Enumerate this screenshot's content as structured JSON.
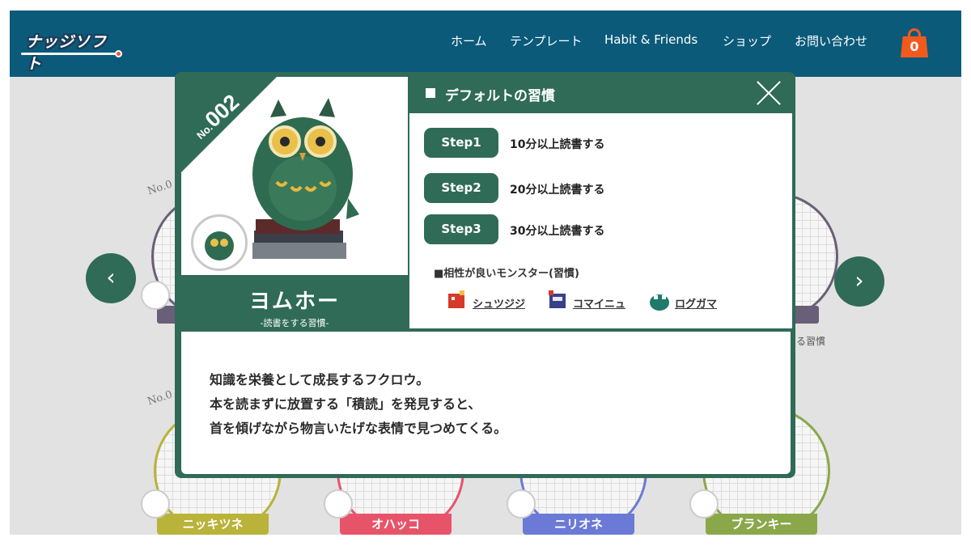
{
  "header": {
    "logo_text": "ナッジソフト",
    "nav": [
      {
        "label": "ホーム"
      },
      {
        "label": "テンプレート"
      },
      {
        "label": "Habit & Friends"
      },
      {
        "label": "ショップ"
      },
      {
        "label": "お問い合わせ"
      }
    ],
    "cart_count": "0"
  },
  "background_cards": [
    {
      "no": "No.0",
      "label": "",
      "color": "#6a5f78"
    },
    {
      "no": "No.0",
      "label": "ニッキツネ",
      "color": "#b9b33a"
    },
    {
      "no": "",
      "label": "オハッコ",
      "color": "#e7546a"
    },
    {
      "no": "",
      "label": "ニリオネ",
      "color": "#6b7ad6"
    },
    {
      "no": "",
      "label": "ブランキー",
      "color": "#8aa84a"
    },
    {
      "no": "",
      "label": "",
      "color": "#6a5f78",
      "tag": "る習慣"
    }
  ],
  "arrows": {
    "prev": "‹",
    "next": "›"
  },
  "modal": {
    "no_prefix": "No.",
    "number": "002",
    "name": "ヨムホー",
    "subtitle": "-読書をする習慣-",
    "section_title": "デフォルトの習慣",
    "steps": [
      {
        "label": "Step1",
        "text": "10分以上読書する"
      },
      {
        "label": "Step2",
        "text": "20分以上読書する"
      },
      {
        "label": "Step3",
        "text": "30分以上読書する"
      }
    ],
    "compat_title": "■相性が良いモンスター(習慣)",
    "friends": [
      {
        "name": "シュツジジ",
        "icon": "red-dragon-icon",
        "color": "#d63a2a"
      },
      {
        "name": "コマイニュ",
        "icon": "armored-creature-icon",
        "color": "#3a3f8a"
      },
      {
        "name": "ログガマ",
        "icon": "green-frog-icon",
        "color": "#1e7a6a"
      }
    ],
    "description": [
      "知識を栄養として成長するフクロウ。",
      "本を読まずに放置する「積読」を発見すると、",
      "首を傾げながら物言いたげな表情で見つめてくる。"
    ]
  },
  "colors": {
    "header_bg": "#0b5a7a",
    "modal_green": "#2f6b57",
    "cart_orange": "#f25a1d"
  }
}
